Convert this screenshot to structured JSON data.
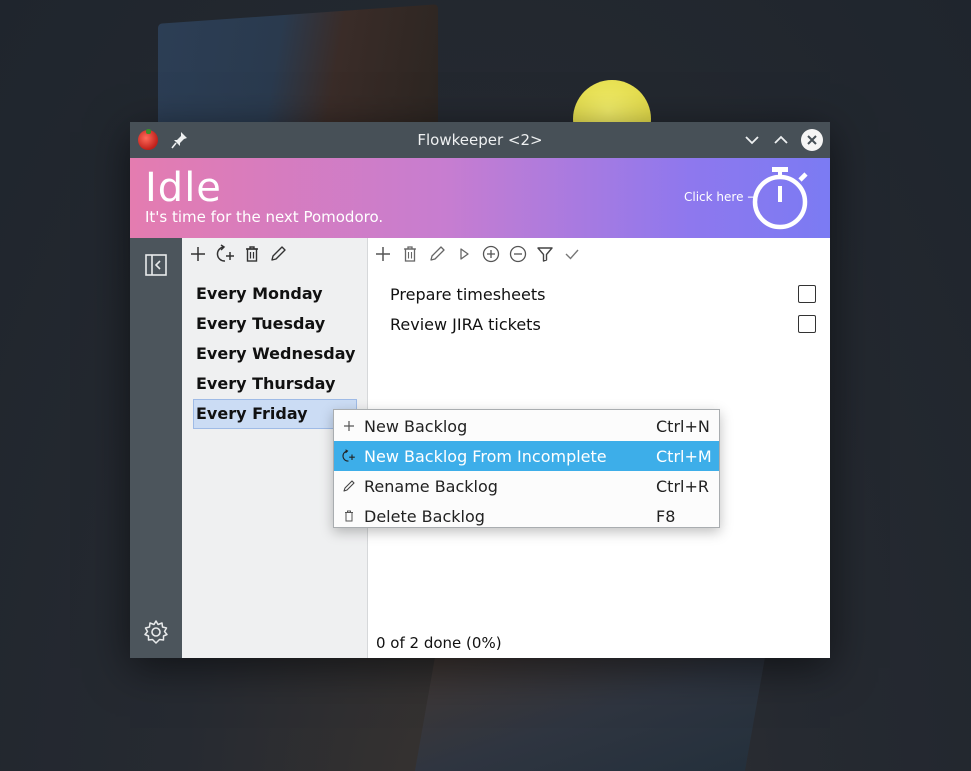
{
  "window": {
    "title": "Flowkeeper <2>"
  },
  "header": {
    "state": "Idle",
    "message": "It's time for the next Pomodoro.",
    "click_hint": "Click here →"
  },
  "backlogs": {
    "items": [
      {
        "label": "Every Monday"
      },
      {
        "label": "Every Tuesday"
      },
      {
        "label": "Every Wednesday"
      },
      {
        "label": "Every Thursday"
      },
      {
        "label": "Every Friday"
      }
    ],
    "selected_index": 4
  },
  "workitems": {
    "items": [
      {
        "label": "Prepare timesheets",
        "done": false
      },
      {
        "label": "Review JIRA tickets",
        "done": false
      }
    ],
    "status": "0 of 2 done (0%)"
  },
  "context_menu": {
    "items": [
      {
        "label": "New Backlog",
        "shortcut": "Ctrl+N",
        "icon": "plus-icon"
      },
      {
        "label": "New Backlog From Incomplete",
        "shortcut": "Ctrl+M",
        "icon": "new-from-incomplete-icon"
      },
      {
        "label": "Rename Backlog",
        "shortcut": "Ctrl+R",
        "icon": "pencil-icon"
      },
      {
        "label": "Delete Backlog",
        "shortcut": "F8",
        "icon": "trash-icon"
      }
    ],
    "highlighted_index": 1
  },
  "colors": {
    "titlebar": "#475057",
    "header_gradient_start": "#e47cb0",
    "header_gradient_end": "#7b7bf3",
    "selection": "#cbdcf4",
    "menu_highlight": "#3daee9"
  }
}
